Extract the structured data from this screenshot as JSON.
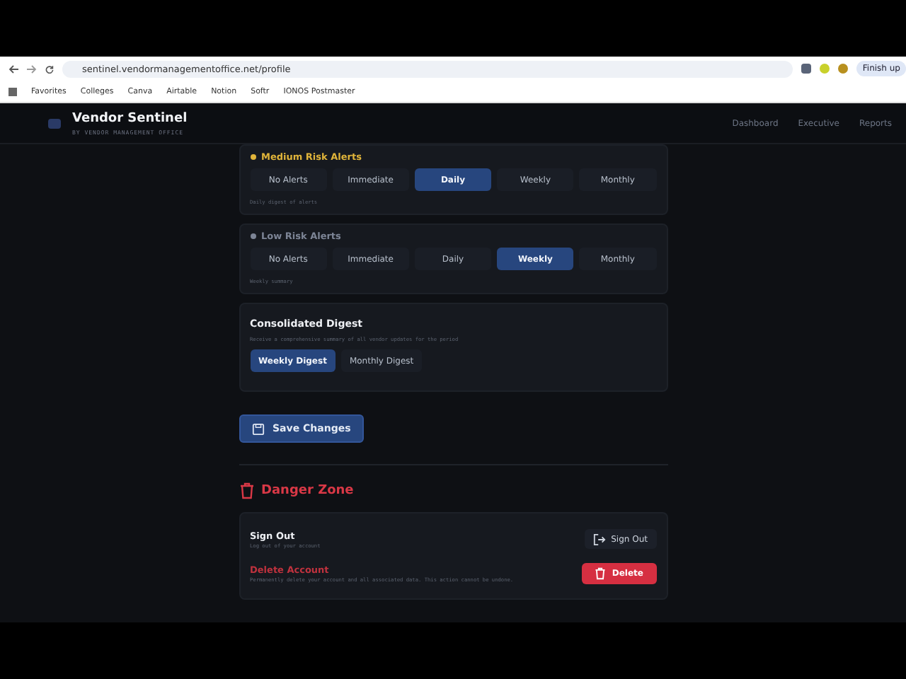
{
  "browser": {
    "url": "sentinel.vendormanagementoffice.net/profile",
    "bookmarks": [
      "Favorites",
      "Colleges",
      "Canva",
      "Airtable",
      "Notion",
      "Softr",
      "IONOS Postmaster"
    ],
    "profile_button": "Finish up"
  },
  "app_header": {
    "title": "Vendor Sentinel",
    "subtitle": "BY VENDOR MANAGEMENT OFFICE",
    "nav": [
      {
        "label": "Dashboard"
      },
      {
        "label": "Executive"
      },
      {
        "label": "Reports"
      }
    ]
  },
  "alert_groups": [
    {
      "title": "Medium Risk Alerts",
      "color": "#e0b43a",
      "note": "Daily digest of alerts",
      "options": [
        {
          "label": "No Alerts",
          "selected": false
        },
        {
          "label": "Immediate",
          "selected": false
        },
        {
          "label": "Daily",
          "selected": true
        },
        {
          "label": "Weekly",
          "selected": false
        },
        {
          "label": "Monthly",
          "selected": false
        }
      ]
    },
    {
      "title": "Low Risk Alerts",
      "color": "#7d8596",
      "note": "Weekly summary",
      "options": [
        {
          "label": "No Alerts",
          "selected": false
        },
        {
          "label": "Immediate",
          "selected": false
        },
        {
          "label": "Daily",
          "selected": false
        },
        {
          "label": "Weekly",
          "selected": true
        },
        {
          "label": "Monthly",
          "selected": false
        }
      ]
    }
  ],
  "digest": {
    "title": "Consolidated Digest",
    "description": "Receive a comprehensive summary of all vendor updates for the period",
    "options": [
      {
        "label": "Weekly Digest",
        "selected": true
      },
      {
        "label": "Monthly Digest",
        "selected": false
      }
    ]
  },
  "save_button": "Save Changes",
  "danger_zone": {
    "title": "Danger Zone",
    "rows": [
      {
        "kind": "signout",
        "title": "Sign Out",
        "description": "Log out of your account",
        "button": "Sign Out"
      },
      {
        "kind": "delete",
        "title": "Delete Account",
        "description": "Permanently delete your account and all associated data. This action cannot be undone.",
        "button": "Delete"
      }
    ]
  }
}
